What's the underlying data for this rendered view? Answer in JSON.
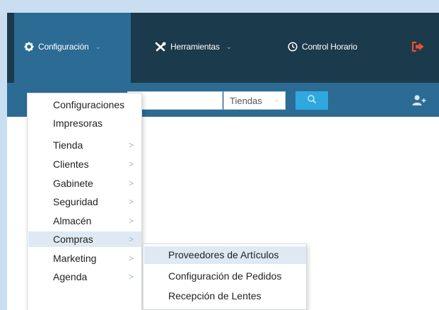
{
  "header": {
    "nav": [
      {
        "label": "Configuración",
        "icon": "gear-icon"
      },
      {
        "label": "Herramientas",
        "icon": "tools-icon"
      },
      {
        "label": "Control Horario",
        "icon": "clock-icon"
      },
      {
        "label": "",
        "icon": "logout-icon"
      }
    ]
  },
  "toolbar": {
    "search_value": "",
    "store_select": "Tiendas",
    "search_button_icon": "search-icon",
    "add_user_icon": "add-user-icon"
  },
  "menu": {
    "items": [
      {
        "label": "Configuraciones",
        "submenu": false
      },
      {
        "label": "Impresoras",
        "submenu": false
      },
      {
        "label": "Tienda",
        "submenu": true
      },
      {
        "label": "Clientes",
        "submenu": true
      },
      {
        "label": "Gabinete",
        "submenu": true
      },
      {
        "label": "Seguridad",
        "submenu": true
      },
      {
        "label": "Almacén",
        "submenu": true
      },
      {
        "label": "Compras",
        "submenu": true,
        "highlighted": true
      },
      {
        "label": "Marketing",
        "submenu": true
      },
      {
        "label": "Agenda",
        "submenu": true
      }
    ]
  },
  "submenu": {
    "items": [
      {
        "label": "Proveedores de Artículos",
        "highlighted": true
      },
      {
        "label": "Configuración de Pedidos"
      },
      {
        "label": "Recepción de Lentes"
      }
    ]
  },
  "colors": {
    "topbar": "#1b3a4b",
    "active_nav": "#2c6b94",
    "search_button": "#2fa8e0",
    "logout_icon": "#e8502e",
    "menu_highlight": "#dfe9f3"
  }
}
